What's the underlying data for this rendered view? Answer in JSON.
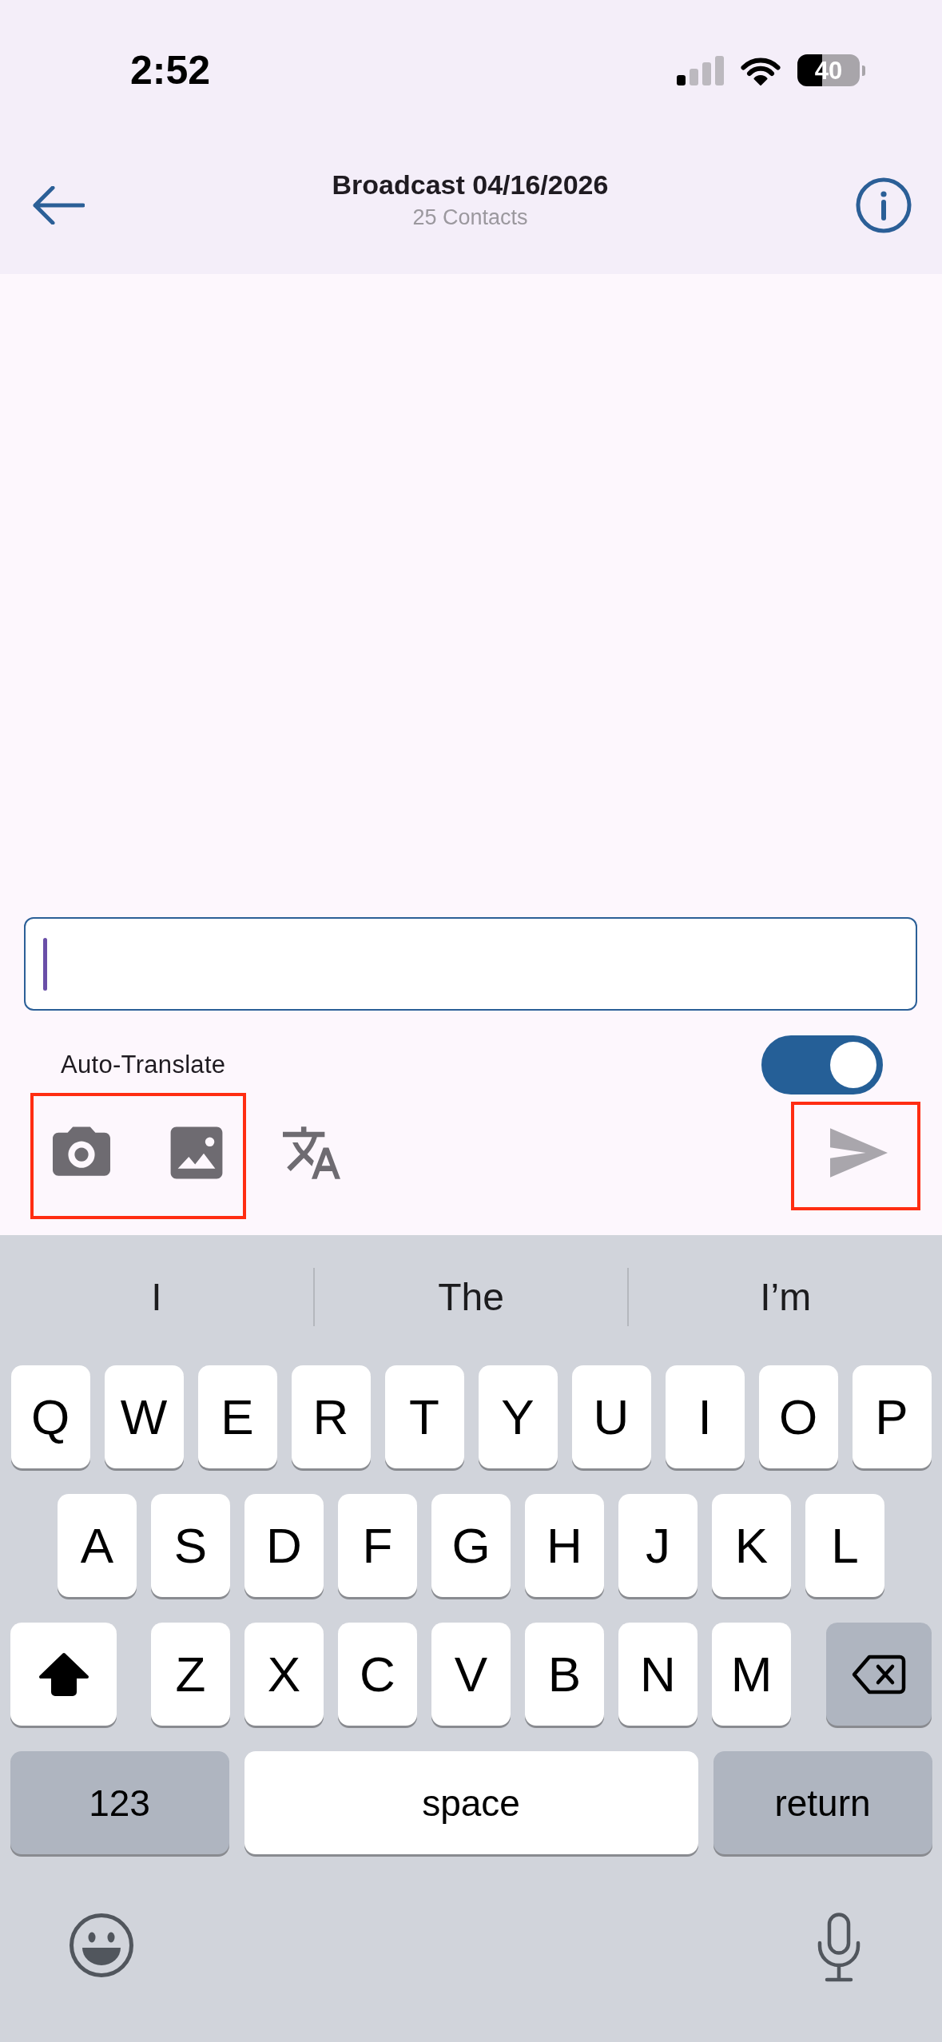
{
  "status_bar": {
    "time": "2:52",
    "battery": "40"
  },
  "header": {
    "title": "Broadcast 04/16/2026",
    "subtitle": "25 Contacts"
  },
  "composer": {
    "message_field": {
      "focused": true
    },
    "auto_translate": {
      "label": "Auto-Translate",
      "on": true
    },
    "toolbar": [
      {
        "highlighted": true,
        "buttons": [
          {
            "kind": "camera"
          },
          {
            "kind": "gallery"
          }
        ]
      },
      {
        "highlighted": false,
        "buttons": [
          {
            "kind": "translate"
          }
        ]
      },
      {
        "highlighted": true,
        "buttons": [
          {
            "kind": "send",
            "disabled": true
          }
        ]
      }
    ]
  },
  "keyboard": {
    "suggestions": [
      "I",
      "The",
      "I’m"
    ],
    "letter_rows": [
      [
        {
          "kind": "letter",
          "label": "Q"
        },
        {
          "kind": "letter",
          "label": "W"
        },
        {
          "kind": "letter",
          "label": "E"
        },
        {
          "kind": "letter",
          "label": "R"
        },
        {
          "kind": "letter",
          "label": "T"
        },
        {
          "kind": "letter",
          "label": "Y"
        },
        {
          "kind": "letter",
          "label": "U"
        },
        {
          "kind": "letter",
          "label": "I"
        },
        {
          "kind": "letter",
          "label": "O"
        },
        {
          "kind": "letter",
          "label": "P"
        }
      ],
      [
        {
          "kind": "letter",
          "label": "A"
        },
        {
          "kind": "letter",
          "label": "S"
        },
        {
          "kind": "letter",
          "label": "D"
        },
        {
          "kind": "letter",
          "label": "F"
        },
        {
          "kind": "letter",
          "label": "G"
        },
        {
          "kind": "letter",
          "label": "H"
        },
        {
          "kind": "letter",
          "label": "J"
        },
        {
          "kind": "letter",
          "label": "K"
        },
        {
          "kind": "letter",
          "label": "L"
        }
      ],
      [
        {
          "kind": "shift",
          "active": true
        },
        {
          "kind": "letter",
          "label": "Z"
        },
        {
          "kind": "letter",
          "label": "X"
        },
        {
          "kind": "letter",
          "label": "C"
        },
        {
          "kind": "letter",
          "label": "V"
        },
        {
          "kind": "letter",
          "label": "B"
        },
        {
          "kind": "letter",
          "label": "N"
        },
        {
          "kind": "letter",
          "label": "M"
        },
        {
          "kind": "backspace"
        }
      ]
    ],
    "bottom_row": {
      "mode_key": "123",
      "space_key": "space",
      "return_key": "return"
    }
  }
}
